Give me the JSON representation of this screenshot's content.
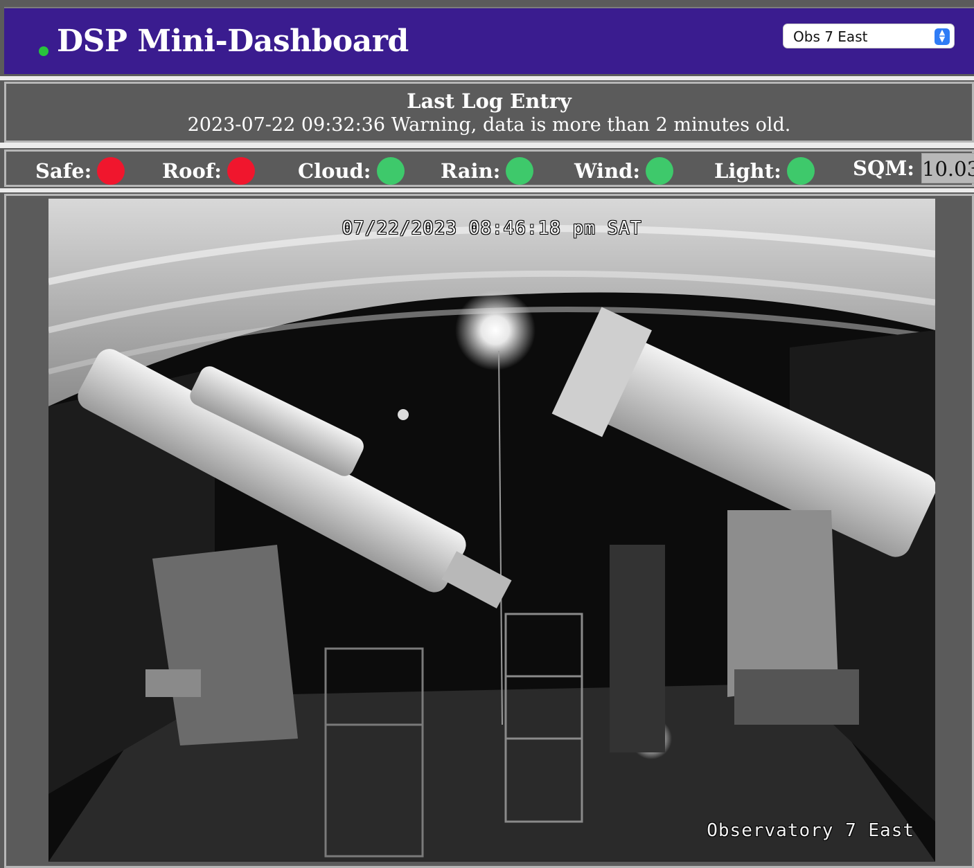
{
  "header": {
    "title": "DSP Mini-Dashboard",
    "status_dot_color": "#28c33c",
    "observatory_select": {
      "selected": "Obs 7 East"
    }
  },
  "log": {
    "title": "Last Log Entry",
    "message": "2023-07-22 09:32:36 Warning, data is more than 2 minutes old."
  },
  "status": {
    "items": [
      {
        "label": "Safe:",
        "state": "red"
      },
      {
        "label": "Roof:",
        "state": "red"
      },
      {
        "label": "Cloud:",
        "state": "green"
      },
      {
        "label": "Rain:",
        "state": "green"
      },
      {
        "label": "Wind:",
        "state": "green"
      },
      {
        "label": "Light:",
        "state": "green"
      }
    ],
    "sqm": {
      "label": "SQM:",
      "value": "10.03"
    },
    "colors": {
      "red": "#f0162d",
      "green": "#3ec96b"
    }
  },
  "camera": {
    "timestamp": "07/22/2023 08:46:18 pm SAT",
    "label": "Observatory 7 East"
  }
}
